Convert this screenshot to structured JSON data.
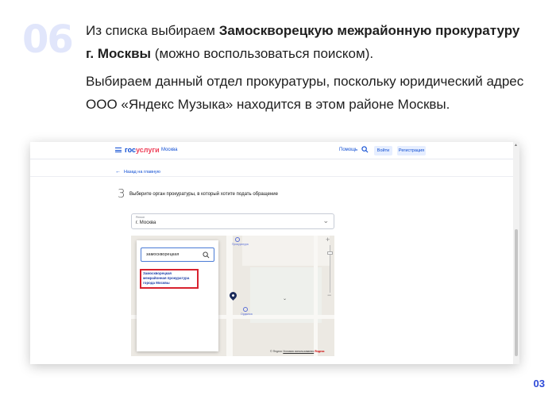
{
  "slide": {
    "step_number": "06",
    "instruction_prefix": "Из списка выбираем ",
    "instruction_bold": "Замоскворецкую межрайонную прокуратуру г. Москвы",
    "instruction_suffix": " (можно воспользоваться поиском).",
    "explanation": "Выбираем данный отдел прокуратуры, поскольку юридический адрес ООО «Яндекс Музыка» находится в этом районе Москвы.",
    "page_number": "03"
  },
  "header": {
    "logo_part1": "гос",
    "logo_part2": "услуги",
    "region": "Москва",
    "help_label": "Помощь",
    "login_label": "Войти",
    "register_label": "Регистрация"
  },
  "breadcrumb": {
    "back_label": "Назад на главную"
  },
  "form": {
    "step": "3",
    "question": "Выберите орган прокуратуры, в который хотите подать обращение",
    "select_label": "Регион",
    "select_value": "г. Москва"
  },
  "map": {
    "search_value": "замоскворецкая",
    "result_text": "Замоскворецкая межрайонная прокуратура города Москвы",
    "poi1_label": "Прокуратура",
    "poi2_label": "Ордынка",
    "attribution_prefix": "© Яндекс ",
    "attribution_link": "Условия использования",
    "attribution_brand": "Яндекс"
  },
  "colors": {
    "accent": "#0d4cd3",
    "highlight_border": "#d8222f",
    "step_number": "#e1e6fb",
    "page_number": "#2f4bd8"
  }
}
